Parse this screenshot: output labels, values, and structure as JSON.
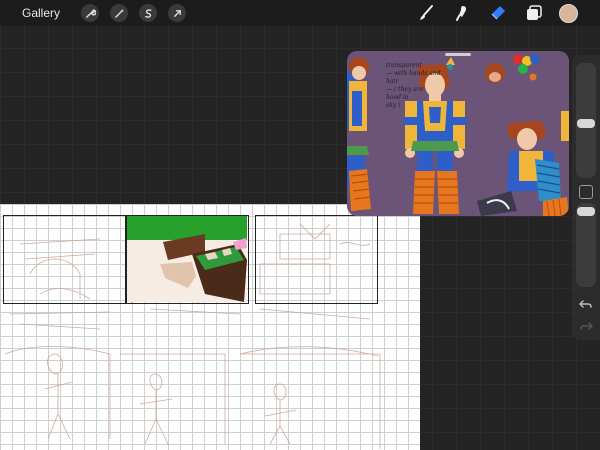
{
  "topbar": {
    "gallery_label": "Gallery",
    "left_tools": [
      "wrench-icon",
      "magic-wand-icon",
      "selection-icon",
      "transform-arrow-icon"
    ],
    "right_tools": [
      "brush-icon",
      "smudge-icon",
      "eraser-icon",
      "layers-icon",
      "color-icon"
    ],
    "active_tool": "eraser-icon",
    "active_color": "#d8b598"
  },
  "sidebar": {
    "brush_size": 0.45,
    "brush_opacity": 0.0,
    "undo_icon": "undo-icon",
    "redo_icon": "redo-icon"
  },
  "reference": {
    "note": "transparent\n— with hands and\nhair\n— ( they are\nhood in\nsky )"
  }
}
